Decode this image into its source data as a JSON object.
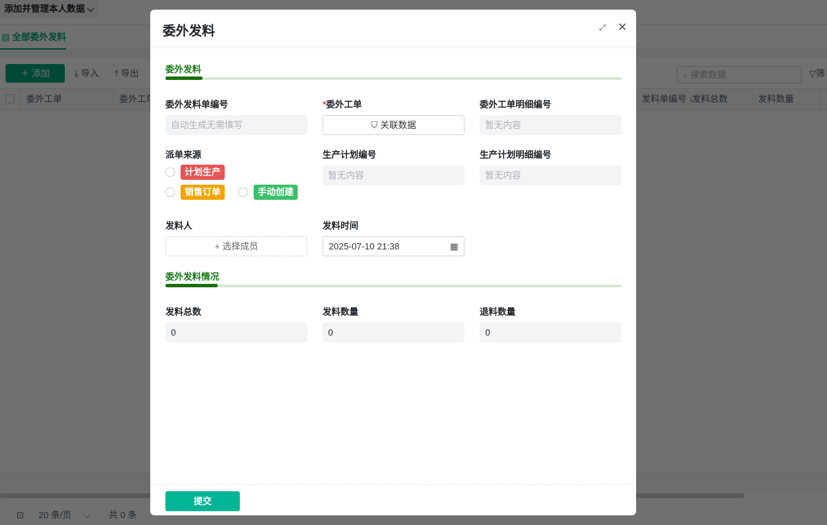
{
  "page": {
    "top_button": "添加并管理本人数据",
    "tab": "全部委外发料",
    "toolbar": {
      "add": "添加",
      "import": "导入",
      "export": "导出",
      "search_placeholder": "搜索数据",
      "filter": "筛"
    },
    "columns": [
      "委外工单",
      "委外工单",
      "发料单编号 ↓",
      "发料总数",
      "发料数量"
    ],
    "pager": {
      "page_size": "20 条/页",
      "total": "共 0 条"
    }
  },
  "modal": {
    "title": "委外发料",
    "section1": {
      "title": "委外发料",
      "fields": {
        "code": {
          "label": "委外发料单编号",
          "placeholder": "自动生成无需填写"
        },
        "order": {
          "required": "*",
          "label": "委外工单",
          "button": "关联数据"
        },
        "order_detail": {
          "label": "委外工单明细编号",
          "placeholder": "暂无内容"
        },
        "source": {
          "label": "派单来源",
          "options": [
            {
              "label": "计划生产",
              "color": "#e85454"
            },
            {
              "label": "销售订单",
              "color": "#f0a500"
            },
            {
              "label": "手动创建",
              "color": "#3cc06a"
            }
          ]
        },
        "plan_code": {
          "label": "生产计划编号",
          "placeholder": "暂无内容"
        },
        "plan_detail": {
          "label": "生产计划明细编号",
          "placeholder": "暂无内容"
        },
        "issuer": {
          "label": "发料人",
          "button": "+ 选择成员"
        },
        "time": {
          "label": "发料时间",
          "value": "2025-07-10 21:38"
        }
      }
    },
    "section2": {
      "title": "委外发料情况",
      "fields": [
        {
          "label": "发料总数",
          "value": "0"
        },
        {
          "label": "发料数量",
          "value": "0"
        },
        {
          "label": "退料数量",
          "value": "0"
        }
      ]
    },
    "submit": "提交"
  }
}
